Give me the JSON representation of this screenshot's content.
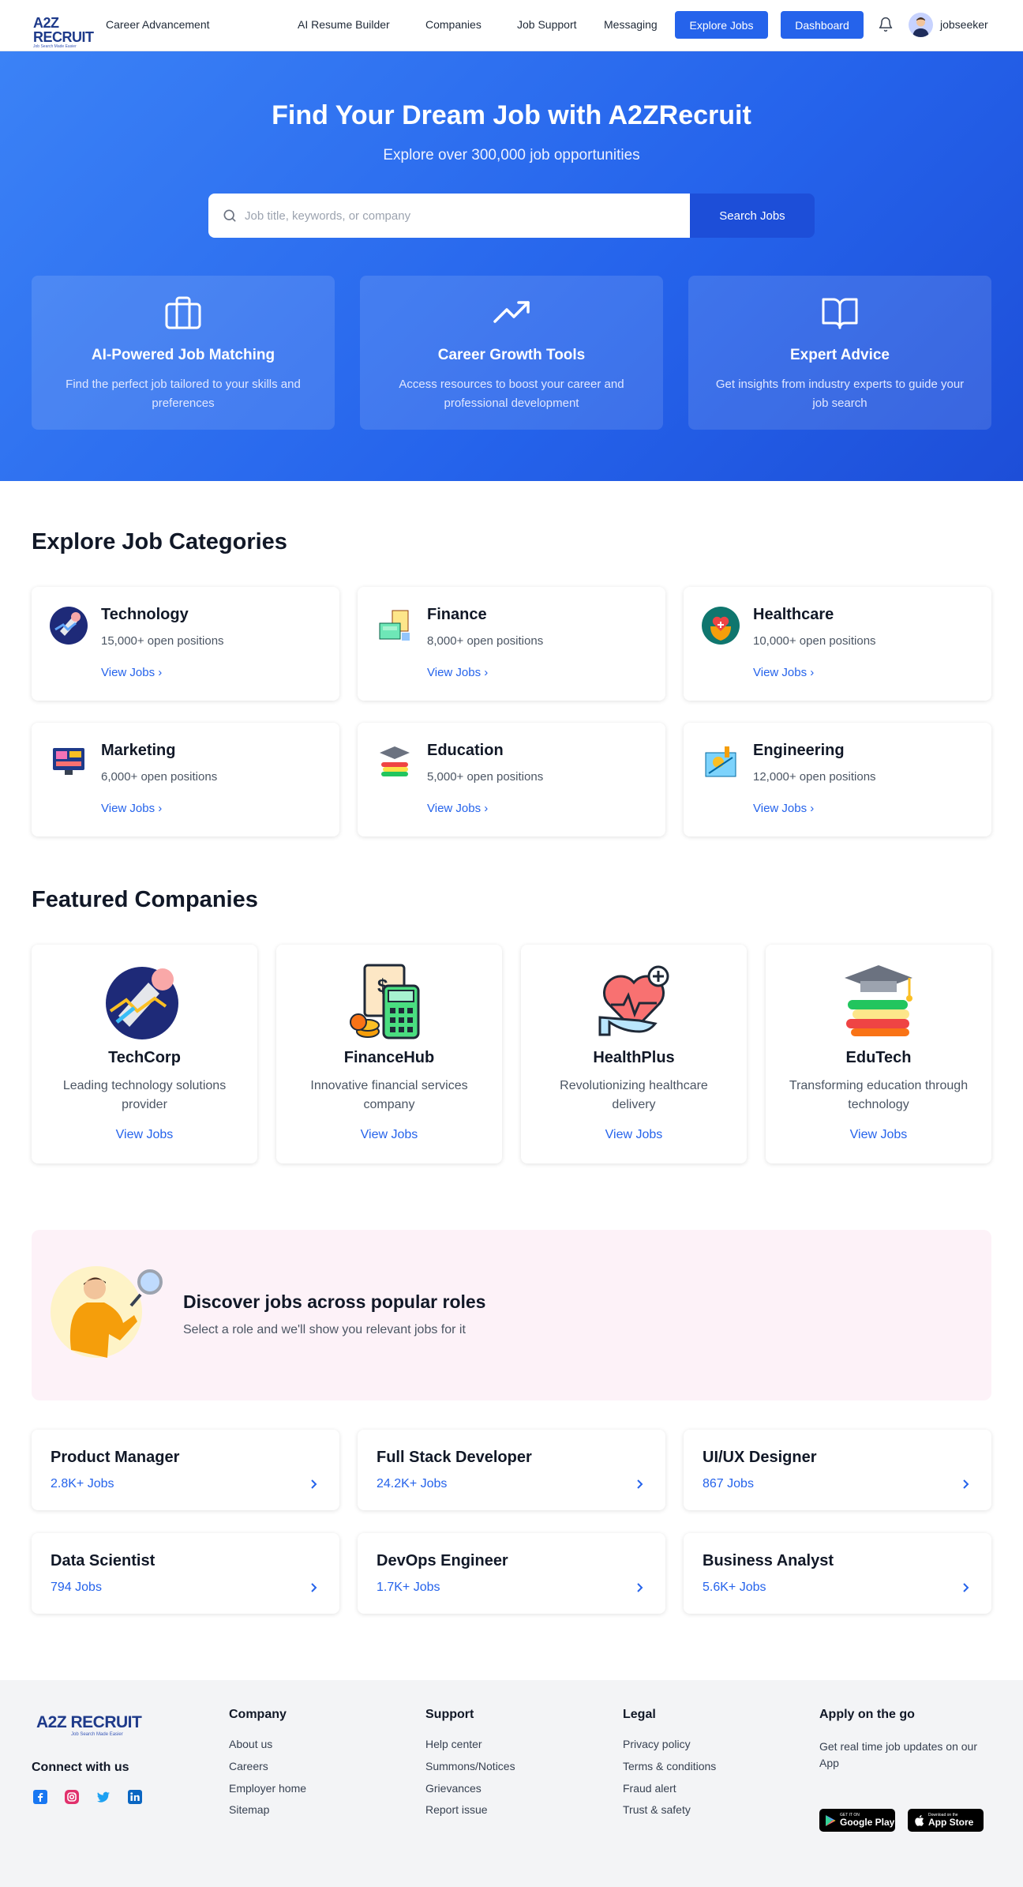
{
  "nav": {
    "logo": "A2Z RECRUIT",
    "logo_tagline": "Job Search Made Easier",
    "brand_tagline": "Career Advancement",
    "links": [
      "AI Resume Builder",
      "Companies",
      "Job Support",
      "Messaging"
    ],
    "explore_button": "Explore Jobs",
    "dashboard_button": "Dashboard",
    "username": "jobseeker"
  },
  "hero": {
    "title": "Find Your Dream Job with A2ZRecruit",
    "subtitle": "Explore over 300,000 job opportunities",
    "search_placeholder": "Job title, keywords, or company",
    "search_button": "Search Jobs",
    "features": [
      {
        "icon": "briefcase-icon",
        "title": "AI-Powered Job Matching",
        "desc": "Find the perfect job tailored to your skills and preferences"
      },
      {
        "icon": "trending-up-icon",
        "title": "Career Growth Tools",
        "desc": "Access resources to boost your career and professional development"
      },
      {
        "icon": "book-open-icon",
        "title": "Expert Advice",
        "desc": "Get insights from industry experts to guide your job search"
      }
    ]
  },
  "categories": {
    "title": "Explore Job Categories",
    "items": [
      {
        "name": "Technology",
        "count": "15,000+ open positions",
        "link": "View Jobs",
        "icon": "technology-icon"
      },
      {
        "name": "Finance",
        "count": "8,000+ open positions",
        "link": "View Jobs",
        "icon": "finance-icon"
      },
      {
        "name": "Healthcare",
        "count": "10,000+ open positions",
        "link": "View Jobs",
        "icon": "healthcare-icon"
      },
      {
        "name": "Marketing",
        "count": "6,000+ open positions",
        "link": "View Jobs",
        "icon": "marketing-icon"
      },
      {
        "name": "Education",
        "count": "5,000+ open positions",
        "link": "View Jobs",
        "icon": "education-icon"
      },
      {
        "name": "Engineering",
        "count": "12,000+ open positions",
        "link": "View Jobs",
        "icon": "engineering-icon"
      }
    ]
  },
  "companies": {
    "title": "Featured Companies",
    "items": [
      {
        "name": "TechCorp",
        "desc": "Leading technology solutions provider",
        "link": "View Jobs"
      },
      {
        "name": "FinanceHub",
        "desc": "Innovative financial services company",
        "link": "View Jobs"
      },
      {
        "name": "HealthPlus",
        "desc": "Revolutionizing healthcare delivery",
        "link": "View Jobs"
      },
      {
        "name": "EduTech",
        "desc": "Transforming education through technology",
        "link": "View Jobs"
      }
    ]
  },
  "discover": {
    "title": "Discover jobs across popular roles",
    "subtitle": "Select a role and we'll show you relevant jobs for it"
  },
  "roles": [
    {
      "name": "Product Manager",
      "count": "2.8K+ Jobs"
    },
    {
      "name": "Full Stack Developer",
      "count": "24.2K+ Jobs"
    },
    {
      "name": "UI/UX Designer",
      "count": "867 Jobs"
    },
    {
      "name": "Data Scientist",
      "count": "794 Jobs"
    },
    {
      "name": "DevOps Engineer",
      "count": "1.7K+ Jobs"
    },
    {
      "name": "Business Analyst",
      "count": "5.6K+ Jobs"
    }
  ],
  "footer": {
    "logo": "A2Z RECRUIT",
    "logo_tagline": "Job Search Made Easier",
    "connect": "Connect with us",
    "company": {
      "title": "Company",
      "links": [
        "About us",
        "Careers",
        "Employer home",
        "Sitemap"
      ]
    },
    "support": {
      "title": "Support",
      "links": [
        "Help center",
        "Summons/Notices",
        "Grievances",
        "Report issue"
      ]
    },
    "legal": {
      "title": "Legal",
      "links": [
        "Privacy policy",
        "Terms & conditions",
        "Fraud alert",
        "Trust & safety"
      ]
    },
    "app": {
      "title": "Apply on the go",
      "desc": "Get real time job updates on our App",
      "google_small": "GET IT ON",
      "google_big": "Google Play",
      "apple_small": "Download on the",
      "apple_big": "App Store"
    }
  },
  "colors": {
    "primary": "#2563eb",
    "hero_start": "#3b82f6",
    "hero_end": "#1d4ed8",
    "discover_bg": "#fdf2f8",
    "footer_bg": "#f3f4f6"
  }
}
